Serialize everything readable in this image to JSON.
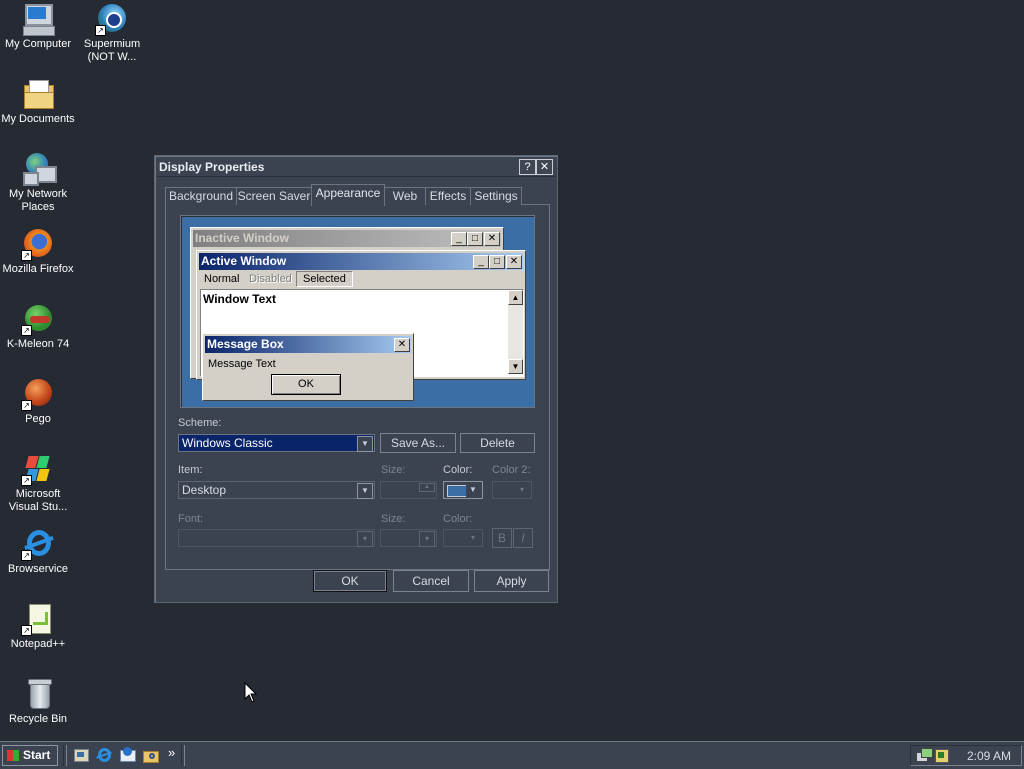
{
  "desktop": {
    "icons": [
      {
        "label": "My Computer"
      },
      {
        "label": "Supermium (NOT W..."
      },
      {
        "label": "My Documents"
      },
      {
        "label": "My Network Places"
      },
      {
        "label": "Mozilla Firefox"
      },
      {
        "label": "K-Meleon 74"
      },
      {
        "label": "Pego"
      },
      {
        "label": "Microsoft Visual Stu..."
      },
      {
        "label": "Browservice"
      },
      {
        "label": "Notepad++"
      },
      {
        "label": "Recycle Bin"
      }
    ]
  },
  "dialog": {
    "title": "Display Properties",
    "help_glyph": "?",
    "close_glyph": "✕",
    "tabs": [
      "Background",
      "Screen Saver",
      "Appearance",
      "Web",
      "Effects",
      "Settings"
    ],
    "selected_tab": "Appearance",
    "preview": {
      "inactive_title": "Inactive Window",
      "active_title": "Active Window",
      "menu": [
        "Normal",
        "Disabled",
        "Selected"
      ],
      "window_text": "Window Text",
      "message_box_title": "Message Box",
      "message_text": "Message Text",
      "ok": "OK"
    },
    "scheme_label": "Scheme:",
    "scheme_value": "Windows Classic",
    "save_as": "Save As...",
    "delete": "Delete",
    "item_label": "Item:",
    "item_value": "Desktop",
    "size_label": "Size:",
    "color_label": "Color:",
    "color2_label": "Color 2:",
    "font_label": "Font:",
    "font_size_label": "Size:",
    "font_color_label": "Color:",
    "bold": "B",
    "italic": "I",
    "color_swatch": "#3a6ea5",
    "buttons": {
      "ok": "OK",
      "cancel": "Cancel",
      "apply": "Apply"
    }
  },
  "taskbar": {
    "start": "Start",
    "chevron": "»",
    "clock": "2:09 AM"
  }
}
